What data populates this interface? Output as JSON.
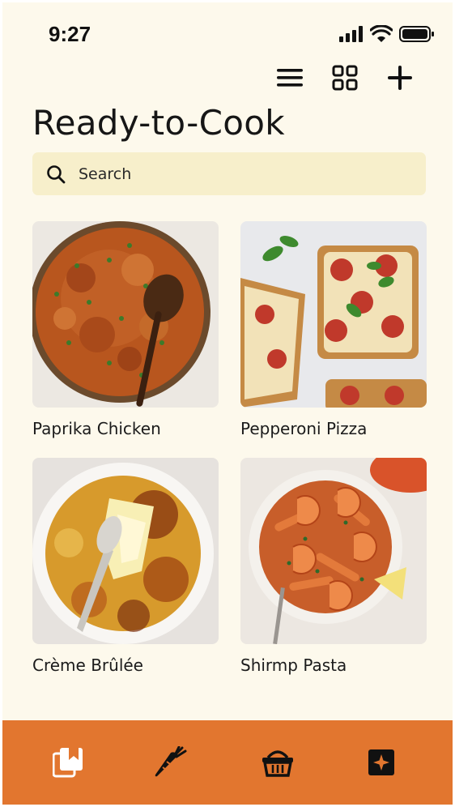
{
  "status": {
    "time": "9:27"
  },
  "header": {
    "title": "Ready-to-Cook"
  },
  "search": {
    "placeholder": "Search"
  },
  "recipes": [
    {
      "name": "Paprika Chicken"
    },
    {
      "name": "Pepperoni Pizza"
    },
    {
      "name": "Crème Brûlée"
    },
    {
      "name": "Shirmp Pasta"
    }
  ],
  "toolbar": {
    "icons": [
      "menu-icon",
      "grid-icon",
      "plus-icon"
    ]
  },
  "bottom_nav": {
    "icons": [
      "bookmark-library-icon",
      "carrot-icon",
      "basket-icon",
      "sparkle-icon"
    ]
  },
  "colors": {
    "background": "#fdf9ec",
    "search_bg": "#f7efcb",
    "accent": "#e2762f",
    "text": "#161616"
  }
}
